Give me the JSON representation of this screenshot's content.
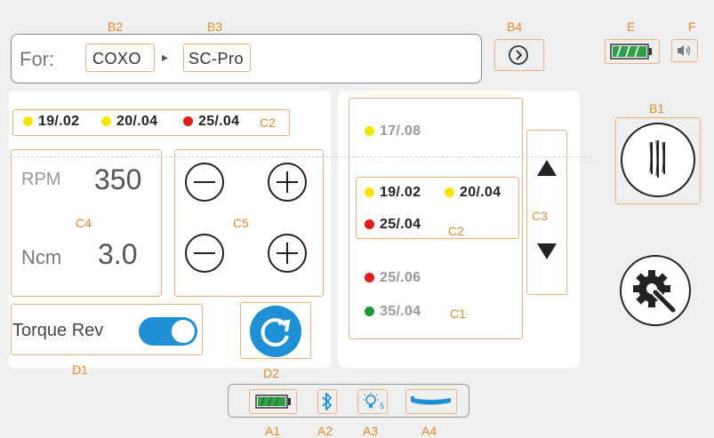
{
  "for_bar": {
    "label": "For:",
    "brand": "COXO",
    "separator": "▸",
    "model": "SC-Pro"
  },
  "status": {
    "battery_icon": "battery-full-icon",
    "sound_icon": "speaker-icon"
  },
  "selected_files": [
    {
      "name": "19/.02",
      "color": "#f5e400"
    },
    {
      "name": "20/.04",
      "color": "#f5e400"
    },
    {
      "name": "25/.04",
      "color": "#e21b1b"
    }
  ],
  "motor": {
    "speed_unit": "RPM",
    "speed_value": "350",
    "torque_unit": "Ncm",
    "torque_value": "3.0"
  },
  "torque_reverse": {
    "label": "Torque Rev",
    "enabled": true
  },
  "file_list": {
    "above": [
      {
        "name": "17/.08",
        "color": "#f5e400"
      }
    ],
    "current": [
      {
        "name": "19/.02",
        "color": "#f5e400"
      },
      {
        "name": "20/.04",
        "color": "#f5e400"
      },
      {
        "name": "25/.04",
        "color": "#e21b1b"
      }
    ],
    "below": [
      {
        "name": "25/.06",
        "color": "#e21b1b"
      },
      {
        "name": "35/.04",
        "color": "#1e9a3c"
      }
    ]
  },
  "labels": {
    "B2": "B2",
    "B3": "B3",
    "B4": "B4",
    "E": "E",
    "F": "F",
    "B1": "B1",
    "C2": "C2",
    "C4": "C4",
    "C5": "C5",
    "C3": "C3",
    "C2b": "C2",
    "C1": "C1",
    "D1": "D1",
    "D2": "D2",
    "A1": "A1",
    "A2": "A2",
    "A3": "A3",
    "A4": "A4"
  },
  "bottom_status": {
    "light_level": "5"
  },
  "colors": {
    "accent": "#1f8fd6",
    "annotation": "#e08a2c",
    "battery": "#2ea043"
  }
}
